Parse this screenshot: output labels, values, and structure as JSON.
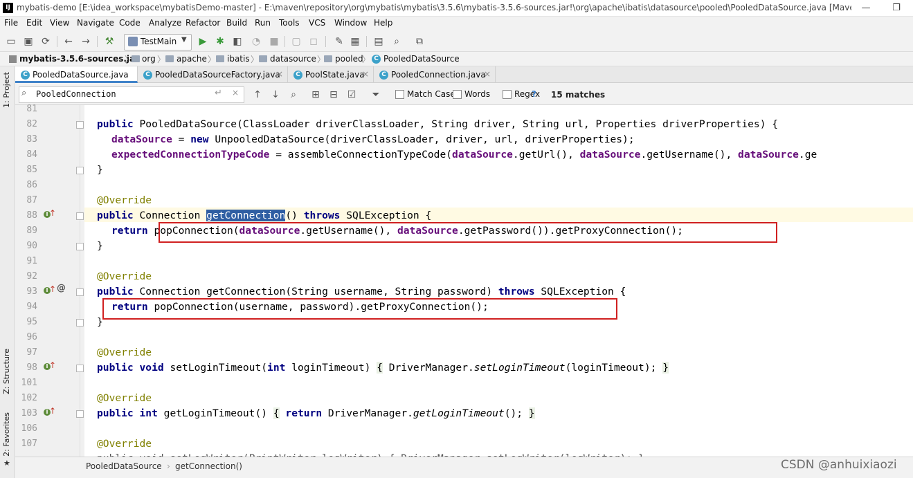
{
  "window": {
    "title": "mybatis-demo [E:\\idea_workspace\\mybatisDemo-master] - E:\\maven\\repository\\org\\mybatis\\mybatis\\3.5.6\\mybatis-3.5.6-sources.jar!\\org\\apache\\ibatis\\datasource\\pooled\\PooledDataSource.java [Maven:...",
    "logo": "IJ",
    "minimize": "—",
    "restore": "❐"
  },
  "menu": [
    "File",
    "Edit",
    "View",
    "Navigate",
    "Code",
    "Analyze",
    "Refactor",
    "Build",
    "Run",
    "Tools",
    "VCS",
    "Window",
    "Help"
  ],
  "toolbar": {
    "run_config": "TestMain"
  },
  "breadcrumb": [
    "mybatis-3.5.6-sources.jar",
    "org",
    "apache",
    "ibatis",
    "datasource",
    "pooled",
    "PooledDataSource"
  ],
  "side_tabs": {
    "project": "1: Project",
    "structure": "Z: Structure",
    "favorites": "2: Favorites"
  },
  "tabs": [
    {
      "label": "PooledDataSource.java",
      "active": true
    },
    {
      "label": "PooledDataSourceFactory.java",
      "active": false
    },
    {
      "label": "PoolState.java",
      "active": false
    },
    {
      "label": "PooledConnection.java",
      "active": false
    }
  ],
  "find": {
    "query": "PooledConnection",
    "match_case": "Match Case",
    "words": "Words",
    "regex": "Regex",
    "help": "?",
    "matches": "15 matches"
  },
  "line_numbers": [
    "81",
    "82",
    "83",
    "84",
    "85",
    "86",
    "87",
    "88",
    "89",
    "90",
    "91",
    "92",
    "93",
    "94",
    "95",
    "96",
    "97",
    "98",
    "101",
    "102",
    "103",
    "106",
    "107"
  ],
  "code": {
    "l82": {
      "kw1": "public",
      "t1": " PooledDataSource(ClassLoader driverClassLoader, String driver, String url, Properties driverProperties) {"
    },
    "l83": {
      "f1": "dataSource",
      "t1": " = ",
      "kw1": "new",
      "t2": " UnpooledDataSource(driverClassLoader, driver, url, driverProperties);"
    },
    "l84": {
      "f1": "expectedConnectionTypeCode",
      "t1": " = assembleConnectionTypeCode(",
      "f2": "dataSource",
      "t2": ".getUrl(), ",
      "f3": "dataSource",
      "t3": ".getUsername(), ",
      "f4": "dataSource",
      "t4": ".ge"
    },
    "l85": "}",
    "l87": "@Override",
    "l88": {
      "kw1": "public",
      "t1": " Connection ",
      "sel": "getConnection",
      "t2": "() ",
      "kw2": "throws",
      "t3": " SQLException {"
    },
    "l89": {
      "kw1": "return",
      "t1": " popConnection(",
      "f1": "dataSource",
      "t2": ".getUsername(), ",
      "f2": "dataSource",
      "t3": ".getPassword()).getProxyConnection();"
    },
    "l90": "}",
    "l92": "@Override",
    "l93": {
      "kw1": "public",
      "t1": " Connection getConnection(String username, String password) ",
      "kw2": "throws",
      "t2": " SQLException {"
    },
    "l94": {
      "kw1": "return",
      "t1": " popConnection(username, password).getProxyConnection();"
    },
    "l95": "}",
    "l97": "@Override",
    "l98": {
      "kw1": "public",
      "kw2": "void",
      "t1": " setLoginTimeout(",
      "kw3": "int",
      "t2": " loginTimeout) ",
      "b1": "{",
      "t3": " DriverManager.",
      "i1": "setLoginTimeout",
      "t4": "(loginTimeout); ",
      "b2": "}"
    },
    "l102": "@Override",
    "l103": {
      "kw1": "public",
      "kw2": "int",
      "t1": " getLoginTimeout() ",
      "b1": "{",
      "t2": " ",
      "kw3": "return",
      "t3": " DriverManager.",
      "i1": "getLoginTimeout",
      "t4": "(); ",
      "b2": "}"
    },
    "l107": "@Override",
    "l108": "public void setLogWriter(PrintWriter logWriter) { DriverManager.setLogWriter(logWriter); }"
  },
  "status_breadcrumb": [
    "PooledDataSource",
    "getConnection()"
  ],
  "watermark": "CSDN @anhuixiaozi"
}
